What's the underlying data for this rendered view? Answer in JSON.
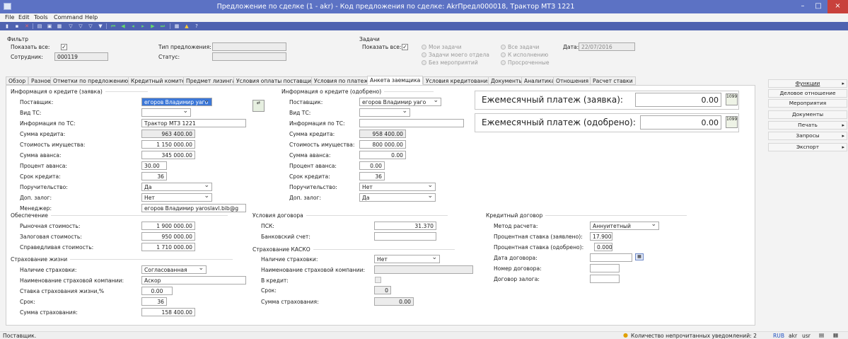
{
  "window": {
    "title": "Предложение по сделке (1 - akr) - Код предложения по сделке: AkrПредл000018, Трактор МТЗ 1221",
    "minimize": "–",
    "maximize": "□",
    "close": "×"
  },
  "menu": [
    "File",
    "Edit",
    "Tools",
    "Command",
    "Help"
  ],
  "filter": {
    "legend": "Фильтр",
    "show_all_label": "Показать все:",
    "show_all_checked": true,
    "employee_label": "Сотрудник:",
    "employee_value": "000119",
    "offer_type_label": "Тип предложения:",
    "offer_type_value": "",
    "status_label": "Статус:",
    "status_value": ""
  },
  "tasks": {
    "legend": "Задачи",
    "show_all_label": "Показать все:",
    "show_all_checked": true,
    "radios": [
      "Мои задачи",
      "Задачи моего отдела",
      "Без мероприятий",
      "Все задачи",
      "К исполнению",
      "Просроченные"
    ],
    "date_label": "Дата:",
    "date_value": "22/07/2016"
  },
  "tabs": [
    "Обзор",
    "Разное",
    "Отметки по предложению",
    "Кредитный комитет",
    "Предмет лизинга",
    "Условия оплаты поставщику",
    "Условия по платежам",
    "Анкета заемщика",
    "Условия кредитования",
    "Документы",
    "Аналитика",
    "Отношения",
    "Расчет ставки"
  ],
  "active_tab": "Анкета заемщика",
  "credit_request": {
    "legend": "Информация о кредите (заявка)",
    "supplier_label": "Поставщик:",
    "supplier_value": "егоров Владимир уаго",
    "vehicle_type_label": "Вид ТС:",
    "vehicle_type_value": "",
    "vehicle_info_label": "Информация по ТС:",
    "vehicle_info_value": "Трактор МТЗ 1221",
    "credit_sum_label": "Сумма кредита:",
    "credit_sum_value": "963 400.00",
    "property_cost_label": "Стоимость имущества:",
    "property_cost_value": "1 150 000.00",
    "advance_sum_label": "Сумма аванса:",
    "advance_sum_value": "345 000.00",
    "advance_pct_label": "Процент аванса:",
    "advance_pct_value": "30.00",
    "term_label": "Срок кредита:",
    "term_value": "36",
    "guarantee_label": "Поручительство:",
    "guarantee_value": "Да",
    "collateral_label": "Доп. залог:",
    "collateral_value": "Нет",
    "manager_label": "Менеджер:",
    "manager_value": "егоров Владимир yaroslavl.bib@g"
  },
  "credit_approved": {
    "legend": "Информация о кредите (одобрено)",
    "supplier_label": "Поставщик:",
    "supplier_value": "егоров Владимир уаго",
    "vehicle_type_label": "Вид ТС:",
    "vehicle_type_value": "",
    "vehicle_info_label": "Информация по ТС:",
    "vehicle_info_value": "",
    "credit_sum_label": "Сумма кредита:",
    "credit_sum_value": "958 400.00",
    "property_cost_label": "Стоимость имущества:",
    "property_cost_value": "800 000.00",
    "advance_sum_label": "Сумма аванса:",
    "advance_sum_value": "0.00",
    "advance_pct_label": "Процент аванса:",
    "advance_pct_value": "0.00",
    "term_label": "Срок кредита:",
    "term_value": "36",
    "guarantee_label": "Поручительство:",
    "guarantee_value": "Нет",
    "collateral_label": "Доп. залог:",
    "collateral_value": "Да"
  },
  "payments": {
    "request_label": "Ежемесячный платеж (заявка):",
    "request_value": "0.00",
    "approved_label": "Ежемесячный платеж (одобрено):",
    "approved_value": "0.00"
  },
  "security": {
    "legend": "Обеспечение",
    "market_label": "Рыночная стоимость:",
    "market_value": "1 900 000.00",
    "pledge_label": "Залоговая стоимость:",
    "pledge_value": "950 000.00",
    "fair_label": "Справедливая стоимость:",
    "fair_value": "1 710 000.00"
  },
  "life_insurance": {
    "legend": "Страхование жизни",
    "has_label": "Наличие страховки:",
    "has_value": "Согласованная",
    "company_label": "Наименование страховой компании:",
    "company_value": "Аскор",
    "rate_label": "Ставка страхования жизни,%",
    "rate_value": "0.00",
    "term_label": "Срок:",
    "term_value": "36",
    "sum_label": "Сумма страхования:",
    "sum_value": "158 400.00"
  },
  "contract_terms": {
    "legend": "Условия договора",
    "psk_label": "ПСК:",
    "psk_value": "31.370",
    "account_label": "Банковский счет:",
    "account_value": ""
  },
  "kasko": {
    "legend": "Страхование КАСКО",
    "has_label": "Наличие страховки:",
    "has_value": "Нет",
    "company_label": "Наименование страховой компании:",
    "company_value": "",
    "credit_label": "В кредит:",
    "credit_checked": false,
    "term_label": "Срок:",
    "term_value": "0",
    "sum_label": "Сумма страхования:",
    "sum_value": "0.00"
  },
  "credit_contract": {
    "legend": "Кредитный договор",
    "method_label": "Метод расчета:",
    "method_value": "Аннуитетный",
    "rate_declared_label": "Процентная ставка (заявлено):",
    "rate_declared_value": "17.900",
    "rate_approved_label": "Процентная ставка (одобрено):",
    "rate_approved_value": "0.000",
    "date_label": "Дата договора:",
    "date_value": "",
    "number_label": "Номер договора:",
    "number_value": "",
    "pledge_label": "Договор залога:",
    "pledge_value": ""
  },
  "sidebar": [
    {
      "label": "Функции",
      "arrow": "▸"
    },
    {
      "label": "Деловое отношение",
      "arrow": ""
    },
    {
      "label": "Мероприятия",
      "arrow": ""
    },
    {
      "label": "Документы",
      "arrow": ""
    },
    {
      "label": "Печать",
      "arrow": "▸"
    },
    {
      "label": "Запросы",
      "arrow": "▸"
    },
    {
      "label": "Экспорт",
      "arrow": "▸"
    }
  ],
  "statusbar": {
    "left": "Поставщик.",
    "notifications": "Количество непрочитанных уведомлений: 2",
    "currency": "RUB",
    "company": "akr",
    "user": "usr"
  }
}
